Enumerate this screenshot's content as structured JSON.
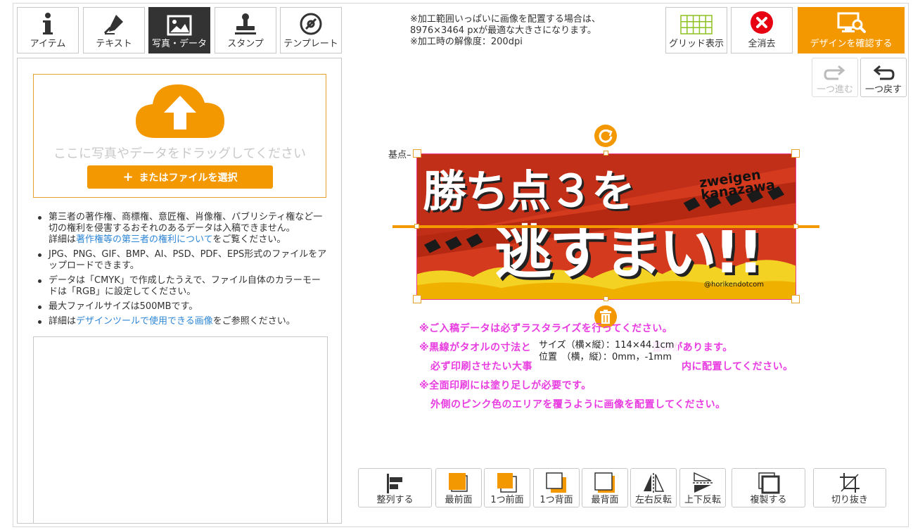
{
  "tabs": [
    {
      "label": "アイテム",
      "icon": "info-icon"
    },
    {
      "label": "テキスト",
      "icon": "pen-icon"
    },
    {
      "label": "写真・データ",
      "icon": "image-icon",
      "active": true
    },
    {
      "label": "スタンプ",
      "icon": "stamp-icon"
    },
    {
      "label": "テンプレート",
      "icon": "template-icon"
    }
  ],
  "info": {
    "line1": "※加工範囲いっぱいに画像を配置する場合は、",
    "line2": "8976×3464 pxが最適な大きさになります。",
    "line3": "※加工時の解像度：200dpi"
  },
  "toolbar": {
    "grid_label": "グリッド表示",
    "clear_label": "全消去",
    "confirm_label": "デザインを確認する",
    "redo_label": "一つ進む",
    "undo_label": "一つ戻す"
  },
  "upload": {
    "drop_text": "ここに写真やデータをドラッグしてください",
    "select_label": "またはファイルを選択",
    "icon": "cloud-upload-icon"
  },
  "notes": {
    "n1a": "第三者の著作権、商標権、意匠権、肖像権、パブリシティ権など一切の権利を侵害するおそれのあるデータは入稿できません。",
    "n1b": "詳細は",
    "n1link": "著作権等の第三者の権利について",
    "n1c": "をご覧ください。",
    "n2": "JPG、PNG、GIF、BMP、AI、PSD、PDF、EPS形式のファイルをアップロードできます。",
    "n3": "データは「CMYK」で作成したうえで、ファイル自体のカラーモードは「RGB」に設定してください。",
    "n4": "最大ファイルサイズは500MBです。",
    "n5a": "詳細は",
    "n5link": "デザインツールで使用できる画像",
    "n5c": "をご参照ください。"
  },
  "canvas": {
    "base_label": "基点",
    "headline1": "勝ち点３を",
    "headline2": "逃すまい!!",
    "brand1": "zweigen",
    "brand2": "kanazawa",
    "handle_tag": "@horikendotcom",
    "size_line1": "サイズ（横×縦）：114×44.1cm",
    "size_line2": "位置　（横，縦）：0mm，-1mm",
    "pink1": "※ご入稿データは必ずラスタライズを行ってください。",
    "pink2": "※黒線がタオルの寸法と",
    "pink2b": "歪みがあります。",
    "pink3": "必ず印刷させたい大事",
    "pink3b": "内に配置してください。",
    "pink4": "※全面印刷には塗り足しが必要です。",
    "pink5": "外側のピンク色のエリアを覆うように画像を配置してください。"
  },
  "tools": [
    {
      "label": "整列する",
      "icon": "align-icon"
    },
    {
      "label": "最前面",
      "icon": "bring-front-icon"
    },
    {
      "label": "1つ前面",
      "icon": "bring-forward-icon"
    },
    {
      "label": "1つ背面",
      "icon": "send-backward-icon"
    },
    {
      "label": "最背面",
      "icon": "send-back-icon"
    },
    {
      "label": "左右反転",
      "icon": "flip-horizontal-icon"
    },
    {
      "label": "上下反転",
      "icon": "flip-vertical-icon"
    },
    {
      "label": "複製する",
      "icon": "duplicate-icon"
    },
    {
      "label": "切り抜き",
      "icon": "crop-icon"
    }
  ],
  "colors": {
    "accent": "#f39800",
    "pink": "#e83ce0",
    "link": "#2e86d6",
    "banner_red": "#d33a1e"
  }
}
